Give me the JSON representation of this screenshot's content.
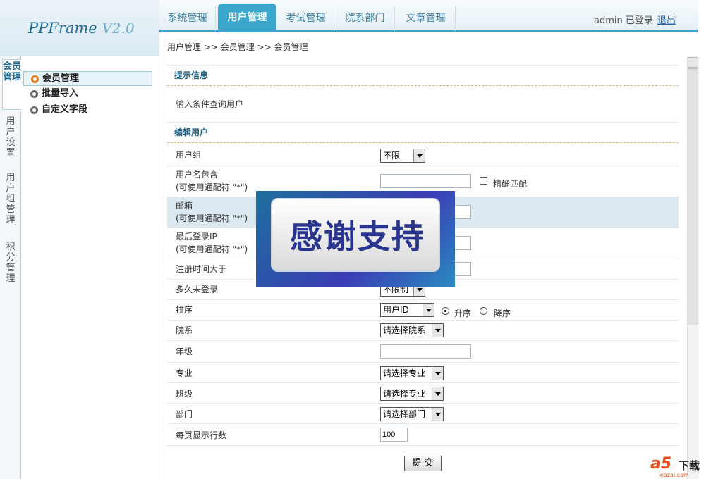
{
  "app": {
    "logo_main": "PPFrame",
    "logo_version": "V2.0"
  },
  "nav": {
    "tabs": [
      {
        "label": "系统管理"
      },
      {
        "label": "用户管理"
      },
      {
        "label": "考试管理"
      },
      {
        "label": "院系部门"
      },
      {
        "label": "文章管理"
      }
    ],
    "user_status": "admin 已登录",
    "logout": "退出"
  },
  "breadcrumb": "用户管理 >> 会员管理 >> 会员管理",
  "vertical_tabs": [
    {
      "label": "会员管理"
    },
    {
      "label": "用户设置"
    },
    {
      "label": "用户组管理"
    },
    {
      "label": "积分管理"
    }
  ],
  "sidebar": {
    "items": [
      {
        "label": "会员管理"
      },
      {
        "label": "批量导入"
      },
      {
        "label": "自定义字段"
      }
    ]
  },
  "tip": {
    "title": "提示信息",
    "text": "输入条件查询用户"
  },
  "form": {
    "title": "编辑用户",
    "user_group": {
      "label": "用户组",
      "value": "不限"
    },
    "username": {
      "label": "用户名包含",
      "hint": "(可使用通配符 \"*\")",
      "value": "",
      "exact_label": "精确匹配"
    },
    "email": {
      "label": "邮箱",
      "hint": "(可使用通配符 \"*\")",
      "value": ""
    },
    "last_ip": {
      "label": "最后登录IP",
      "hint": "(可使用通配符 \"*\")",
      "value": ""
    },
    "reg_time": {
      "label": "注册时间大于",
      "value": ""
    },
    "inactive": {
      "label": "多久未登录",
      "value": "不限制"
    },
    "sort": {
      "label": "排序",
      "value": "用户ID",
      "asc": "升序",
      "desc": "降序"
    },
    "department": {
      "label": "院系",
      "value": "请选择院系"
    },
    "grade": {
      "label": "年级",
      "value": ""
    },
    "major": {
      "label": "专业",
      "value": "请选择专业"
    },
    "class": {
      "label": "班级",
      "value": "请选择专业"
    },
    "dept": {
      "label": "部门",
      "value": "请选择部门"
    },
    "page_size": {
      "label": "每页显示行数",
      "value": "100"
    },
    "submit": "提 交"
  },
  "overlay": {
    "text": "感谢支持"
  },
  "watermark": {
    "brand": "a5",
    "text": "下载",
    "site": "xiazai.com"
  }
}
